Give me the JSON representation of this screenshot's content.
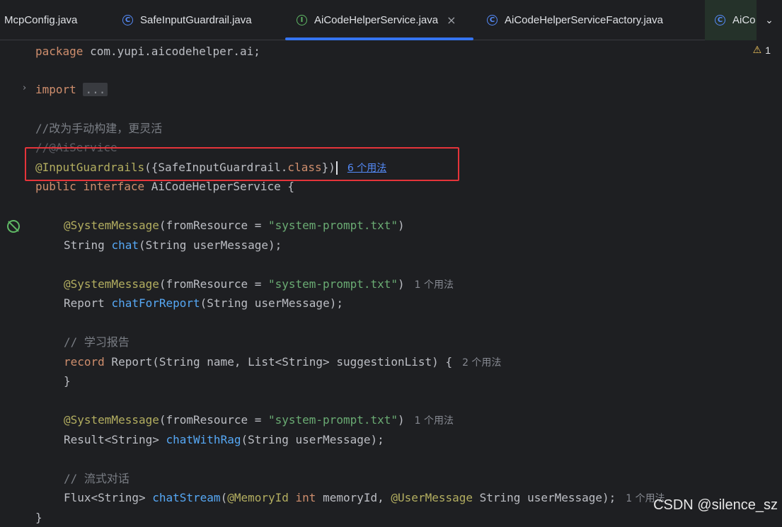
{
  "tabs": [
    {
      "label": "McpConfig.java",
      "icon": "class-icon"
    },
    {
      "label": "SafeInputGuardrail.java",
      "icon": "class-icon",
      "glyph": "C"
    },
    {
      "label": "AiCodeHelperService.java",
      "icon": "interface-icon",
      "glyph": "I",
      "active": true,
      "close": "×"
    },
    {
      "label": "AiCodeHelperServiceFactory.java",
      "icon": "class-icon",
      "glyph": "C"
    },
    {
      "label": "AiCo",
      "icon": "class-icon",
      "glyph": "C"
    }
  ],
  "chevron": "⌄",
  "warnings": {
    "icon": "warning-icon",
    "glyph": "⚠",
    "count": "1"
  },
  "code": {
    "l1_kw": "package",
    "l1_rest": " com.yupi.aicodehelper.ai;",
    "l2_kw": "import",
    "l2_fold": "...",
    "l3_comment": "//改为手动构建，更灵活",
    "l4_comment": "//@AiService",
    "l5_ann": "@InputGuardrails",
    "l5_rest_a": "({SafeInputGuardrail.",
    "l5_kw": "class",
    "l5_rest_b": "})",
    "l5_hint": "6 个用法",
    "l6_kw1": "public",
    "l6_kw2": "interface",
    "l6_rest": " AiCodeHelperService {",
    "l7_ann": "@SystemMessage",
    "l7_a": "(fromResource = ",
    "l7_str": "\"system-prompt.txt\"",
    "l7_b": ")",
    "l8_a": "String ",
    "l8_fn": "chat",
    "l8_b": "(String userMessage);",
    "l9_ann": "@SystemMessage",
    "l9_a": "(fromResource = ",
    "l9_str": "\"system-prompt.txt\"",
    "l9_b": ")",
    "l9_hint": "1 个用法",
    "l10_a": "Report ",
    "l10_fn": "chatForReport",
    "l10_b": "(String userMessage);",
    "l11_comment": "// 学习报告",
    "l12_kw": "record",
    "l12_rest": " Report(String name, List<String> suggestionList) {",
    "l12_hint": "2 个用法",
    "l13": "}",
    "l14_ann": "@SystemMessage",
    "l14_a": "(fromResource = ",
    "l14_str": "\"system-prompt.txt\"",
    "l14_b": ")",
    "l14_hint": "1 个用法",
    "l15_a": "Result<String> ",
    "l15_fn": "chatWithRag",
    "l15_b": "(String userMessage);",
    "l16_comment": "// 流式对话",
    "l17_a": "Flux<String> ",
    "l17_fn": "chatStream",
    "l17_b": "(",
    "l17_ann1": "@MemoryId",
    "l17_kw": " int",
    "l17_c": " memoryId, ",
    "l17_ann2": "@UserMessage",
    "l17_d": " String userMessage);",
    "l17_hint": "1 个用法",
    "l18": "}"
  },
  "watermark": "CSDN @silence_sz"
}
